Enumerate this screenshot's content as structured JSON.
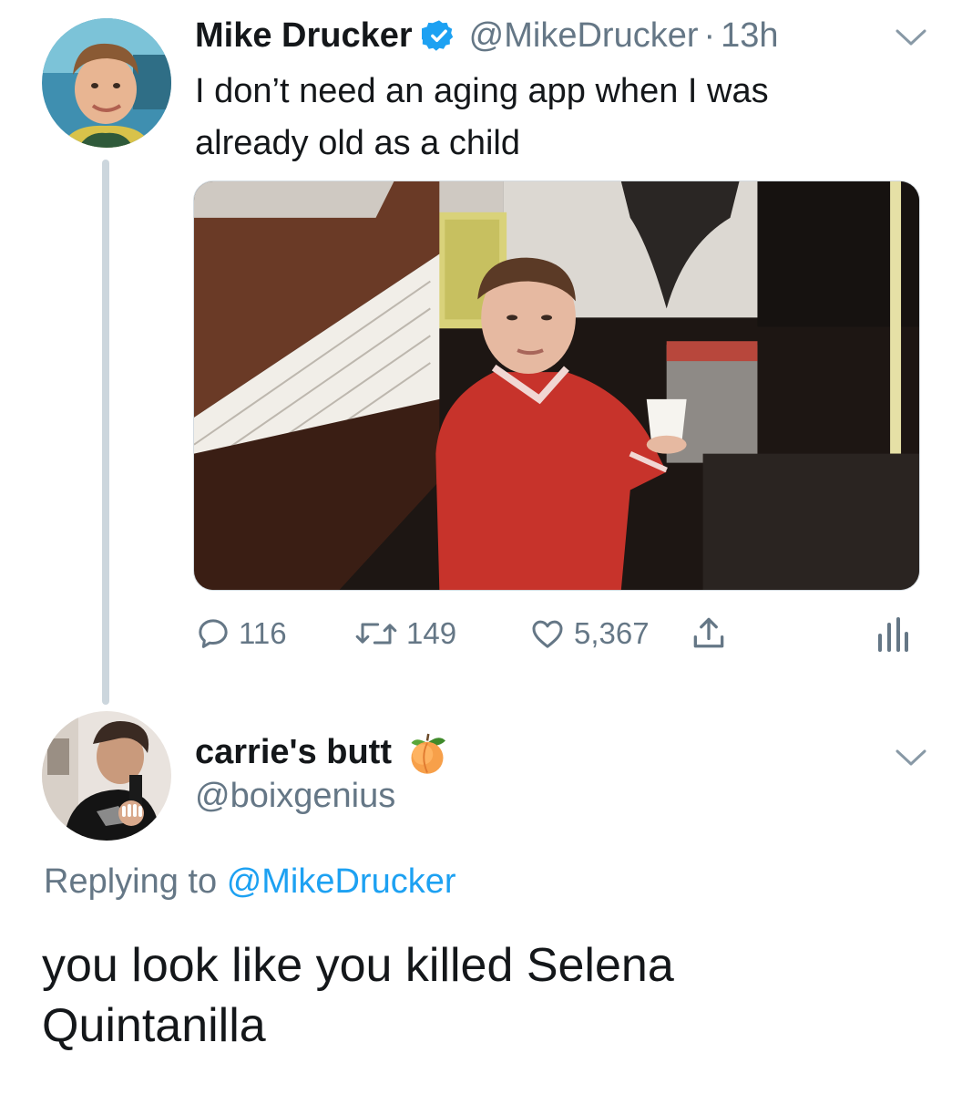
{
  "tweet": {
    "author_name": "Mike Drucker",
    "author_handle": "@MikeDrucker",
    "separator": "·",
    "time": "13h",
    "text": "I don’t need an aging app when I was already old as a child",
    "stats": {
      "replies": "116",
      "retweets": "149",
      "likes": "5,367"
    },
    "icons": [
      "verified-badge-icon",
      "reply-icon",
      "retweet-icon",
      "like-heart-icon",
      "share-icon",
      "analytics-icon",
      "chevron-down-icon"
    ]
  },
  "reply": {
    "author_name": "carrie's butt",
    "author_emoji": "peach-emoji",
    "author_handle": "@boixgenius",
    "replying_prefix": "Replying to",
    "replying_mention": "@MikeDrucker",
    "text": "you look like you killed Selena Quintanilla"
  },
  "colors": {
    "text_primary": "#14171a",
    "text_secondary": "#657786",
    "accent": "#1da1f2",
    "thread_line": "#ccd6dd"
  }
}
